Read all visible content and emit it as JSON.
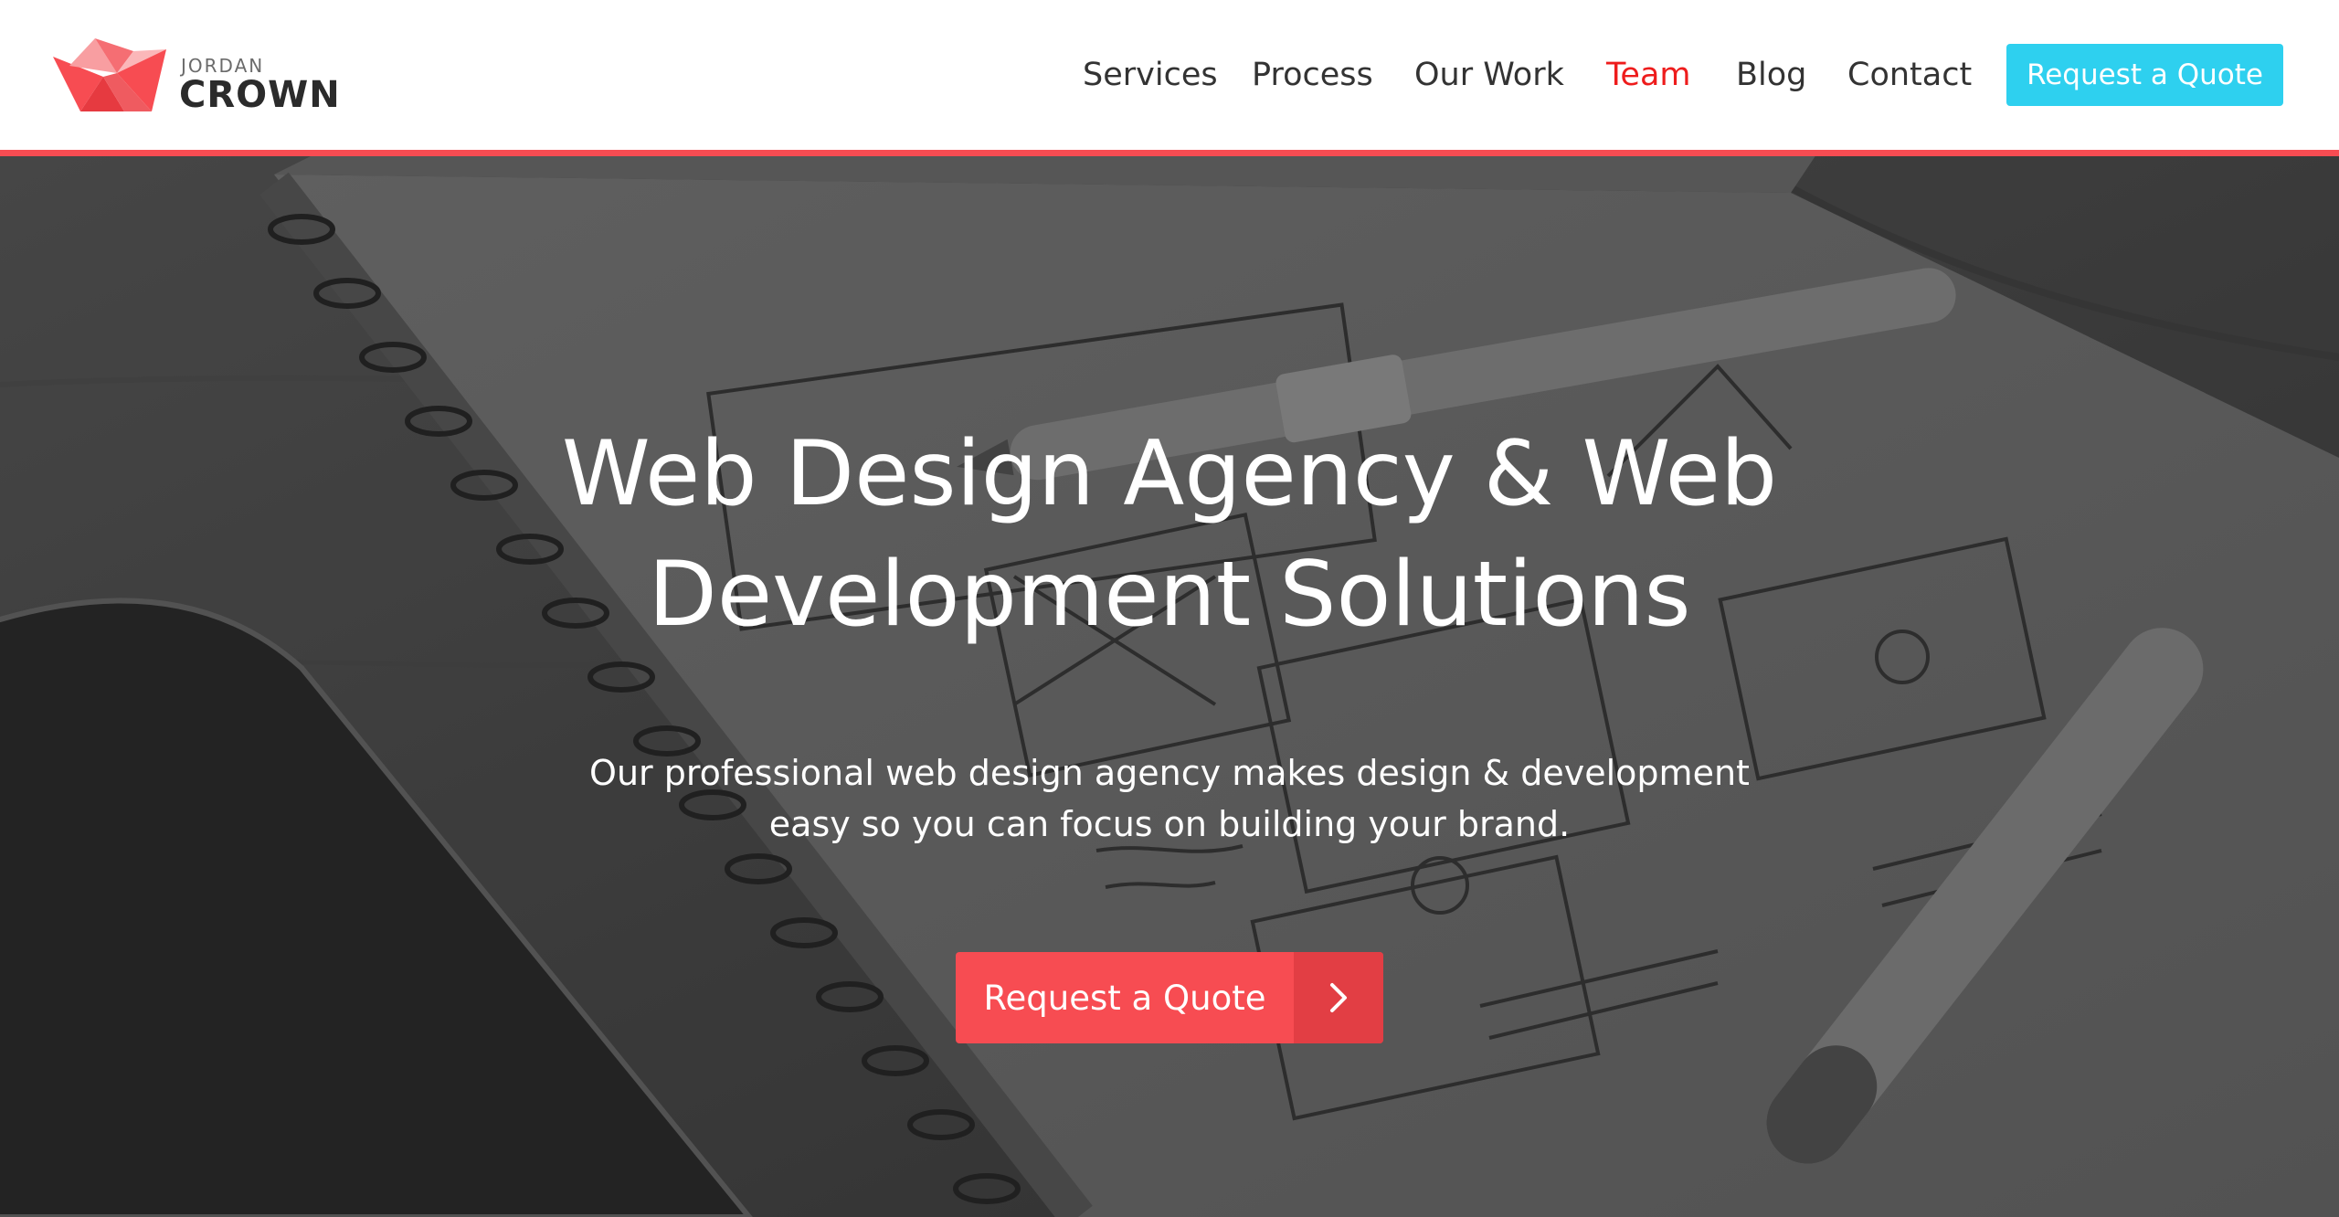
{
  "logo": {
    "top_word": "JORDAN",
    "bottom_word": "CROWN",
    "icon": "crown-logo-icon",
    "colors": [
      "#f74c52",
      "#f89ea1",
      "#e63a40"
    ]
  },
  "nav": {
    "items": [
      {
        "label": "Services",
        "active": false
      },
      {
        "label": "Process",
        "active": false
      },
      {
        "label": "Our Work",
        "active": false
      },
      {
        "label": "Team",
        "active": true
      },
      {
        "label": "Blog",
        "active": false
      },
      {
        "label": "Contact",
        "active": false
      }
    ],
    "cta_label": "Request a Quote"
  },
  "hero": {
    "title_line1": "Web Design Agency & Web",
    "title_line2": "Development Solutions",
    "subtitle_line1": "Our professional web design agency makes design & development",
    "subtitle_line2": "easy so you can focus on building your brand.",
    "cta_label": "Request a Quote",
    "cta_icon": "chevron-right-icon"
  },
  "colors": {
    "accent": "#f74c52",
    "accent_dark": "#e23e44",
    "header_cta": "#2ed0ef",
    "nav_active": "#ee1c1c",
    "nav_text": "#333333"
  }
}
